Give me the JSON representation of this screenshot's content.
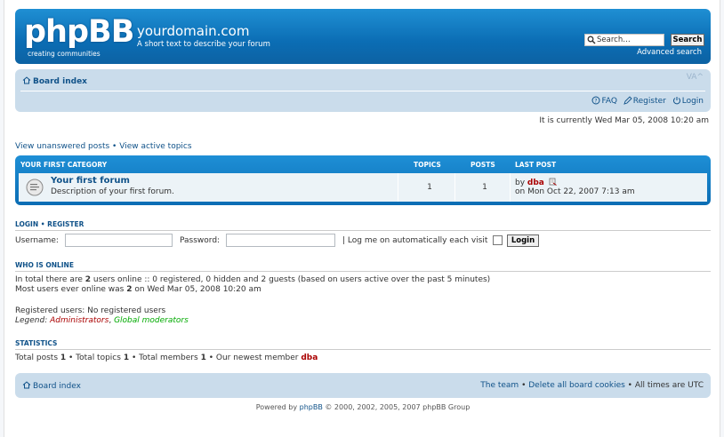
{
  "header": {
    "logo_text": "phpBB",
    "logo_tag_a": "creating",
    "logo_tag_b": "communities",
    "site_title": "yourdomain.com",
    "site_desc": "A short text to describe your forum",
    "search_value": "Search…",
    "search_button": "Search",
    "advanced_search": "Advanced search",
    "brand_color": "#0b6db4"
  },
  "navbar": {
    "board_index": "Board index",
    "font_resize": "VA^",
    "faq": "FAQ",
    "register": "Register",
    "login": "Login"
  },
  "current_time": "It is currently Wed Mar 05, 2008 10:20 am",
  "view_links": {
    "unanswered": "View unanswered posts",
    "sep": "•",
    "active": "View active topics"
  },
  "forum_table": {
    "category": "YOUR FIRST CATEGORY",
    "col_topics": "TOPICS",
    "col_posts": "POSTS",
    "col_lastpost": "LAST POST",
    "rows": [
      {
        "name": "Your first forum",
        "desc": "Description of your first forum.",
        "topics": "1",
        "posts": "1",
        "by_label": "by",
        "by_user": "dba",
        "date": "on Mon Oct 22, 2007 7:13 am"
      }
    ]
  },
  "login": {
    "title_login": "LOGIN",
    "title_sep": "•",
    "title_register": "REGISTER",
    "username_label": "Username:",
    "password_label": "Password:",
    "auto_label": "| Log me on automatically each visit",
    "button": "Login"
  },
  "who_online": {
    "title": "WHO IS ONLINE",
    "line1_a": "In total there are ",
    "line1_count": "2",
    "line1_b": " users online :: 0 registered, 0 hidden and 2 guests (based on users active over the past 5 minutes)",
    "line2_a": "Most users ever online was ",
    "line2_count": "2",
    "line2_b": " on Wed Mar 05, 2008 10:20 am",
    "registered": "Registered users: No registered users",
    "legend_label": "Legend: ",
    "legend_admin": "Administrators",
    "legend_comma": ", ",
    "legend_gmod": "Global moderators"
  },
  "statistics": {
    "title": "STATISTICS",
    "posts_label": "Total posts ",
    "posts": "1",
    "topics_label": " • Total topics ",
    "topics": "1",
    "members_label": " • Total members ",
    "members": "1",
    "newest_label": " • Our newest member ",
    "newest": "dba"
  },
  "footer": {
    "board_index": "Board index",
    "team": "The team",
    "sep": " • ",
    "delete_cookies": "Delete all board cookies",
    "times": "All times are UTC",
    "powered_a": "Powered by ",
    "powered_link": "phpBB",
    "powered_b": " © 2000, 2002, 2005, 2007 phpBB Group"
  }
}
